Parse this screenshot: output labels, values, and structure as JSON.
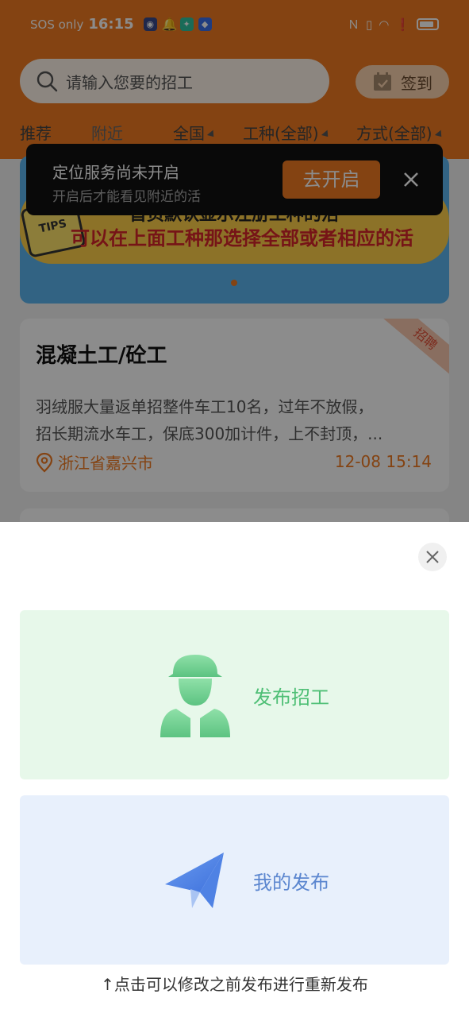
{
  "status_bar": {
    "network": "SOS only",
    "time": "16:15"
  },
  "search": {
    "placeholder": "请输入您要的招工"
  },
  "signin": {
    "label": "签到"
  },
  "filters": {
    "recommend": "推荐",
    "nearby": "附近",
    "region": "全国",
    "trade": "工种(全部)",
    "mode": "方式(全部)"
  },
  "banner": {
    "badge": "TIPS",
    "line1": "首页默认显示注册工种的活",
    "line2": "可以在上面工种那选择全部或者相应的活"
  },
  "location_toast": {
    "title": "定位服务尚未开启",
    "subtitle": "开启后才能看见附近的活",
    "button": "去开启"
  },
  "job_card": {
    "tag": "招聘",
    "title": "混凝土工/砼工",
    "desc_line1": "羽绒服大量返单招整件车工10名，过年不放假，",
    "desc_line2": "招长期流水车工，保底300加计件，上不封顶，...",
    "location": "浙江省嘉兴市",
    "time": "12-08 15:14"
  },
  "sheet": {
    "publish_label": "发布招工",
    "mine_label": "我的发布",
    "hint": "↑点击可以修改之前发布进行重新发布"
  },
  "colors": {
    "brand": "#f07a22",
    "publish_green": "#4fbf76",
    "mine_blue": "#5b86cf"
  }
}
